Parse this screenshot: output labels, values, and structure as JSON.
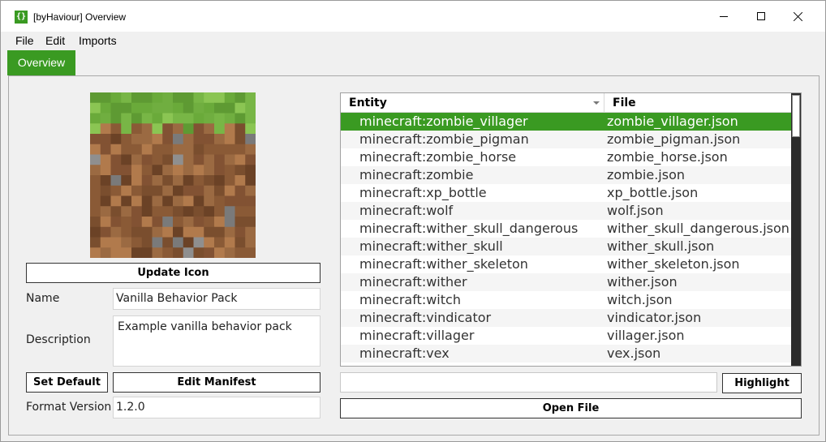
{
  "window": {
    "app_icon_glyph": "{}",
    "title": "[byHaviour] Overview"
  },
  "menu": {
    "items": [
      "File",
      "Edit",
      "Imports"
    ]
  },
  "tabs": [
    {
      "label": "Overview",
      "active": true
    }
  ],
  "pack": {
    "icon_name": "grass-block-icon",
    "update_icon_label": "Update Icon",
    "name_label": "Name",
    "name_value": "Vanilla Behavior Pack",
    "description_label": "Description",
    "description_value": "Example vanilla behavior pack",
    "set_default_label": "Set Default",
    "edit_manifest_label": "Edit Manifest",
    "format_version_label": "Format Version",
    "format_version_value": "1.2.0"
  },
  "entities_table": {
    "columns": [
      "Entity",
      "File"
    ],
    "selected_index": 0,
    "rows": [
      {
        "entity": "minecraft:zombie_villager",
        "file": "zombie_villager.json"
      },
      {
        "entity": "minecraft:zombie_pigman",
        "file": "zombie_pigman.json"
      },
      {
        "entity": "minecraft:zombie_horse",
        "file": "zombie_horse.json"
      },
      {
        "entity": "minecraft:zombie",
        "file": "zombie.json"
      },
      {
        "entity": "minecraft:xp_bottle",
        "file": "xp_bottle.json"
      },
      {
        "entity": "minecraft:wolf",
        "file": "wolf.json"
      },
      {
        "entity": "minecraft:wither_skull_dangerous",
        "file": "wither_skull_dangerous.json"
      },
      {
        "entity": "minecraft:wither_skull",
        "file": "wither_skull.json"
      },
      {
        "entity": "minecraft:wither_skeleton",
        "file": "wither_skeleton.json"
      },
      {
        "entity": "minecraft:wither",
        "file": "wither.json"
      },
      {
        "entity": "minecraft:witch",
        "file": "witch.json"
      },
      {
        "entity": "minecraft:vindicator",
        "file": "vindicator.json"
      },
      {
        "entity": "minecraft:villager",
        "file": "villager.json"
      },
      {
        "entity": "minecraft:vex",
        "file": "vex.json"
      }
    ]
  },
  "search": {
    "value": "",
    "highlight_label": "Highlight"
  },
  "open_file_label": "Open File",
  "colors": {
    "accent": "#3a9a22"
  }
}
